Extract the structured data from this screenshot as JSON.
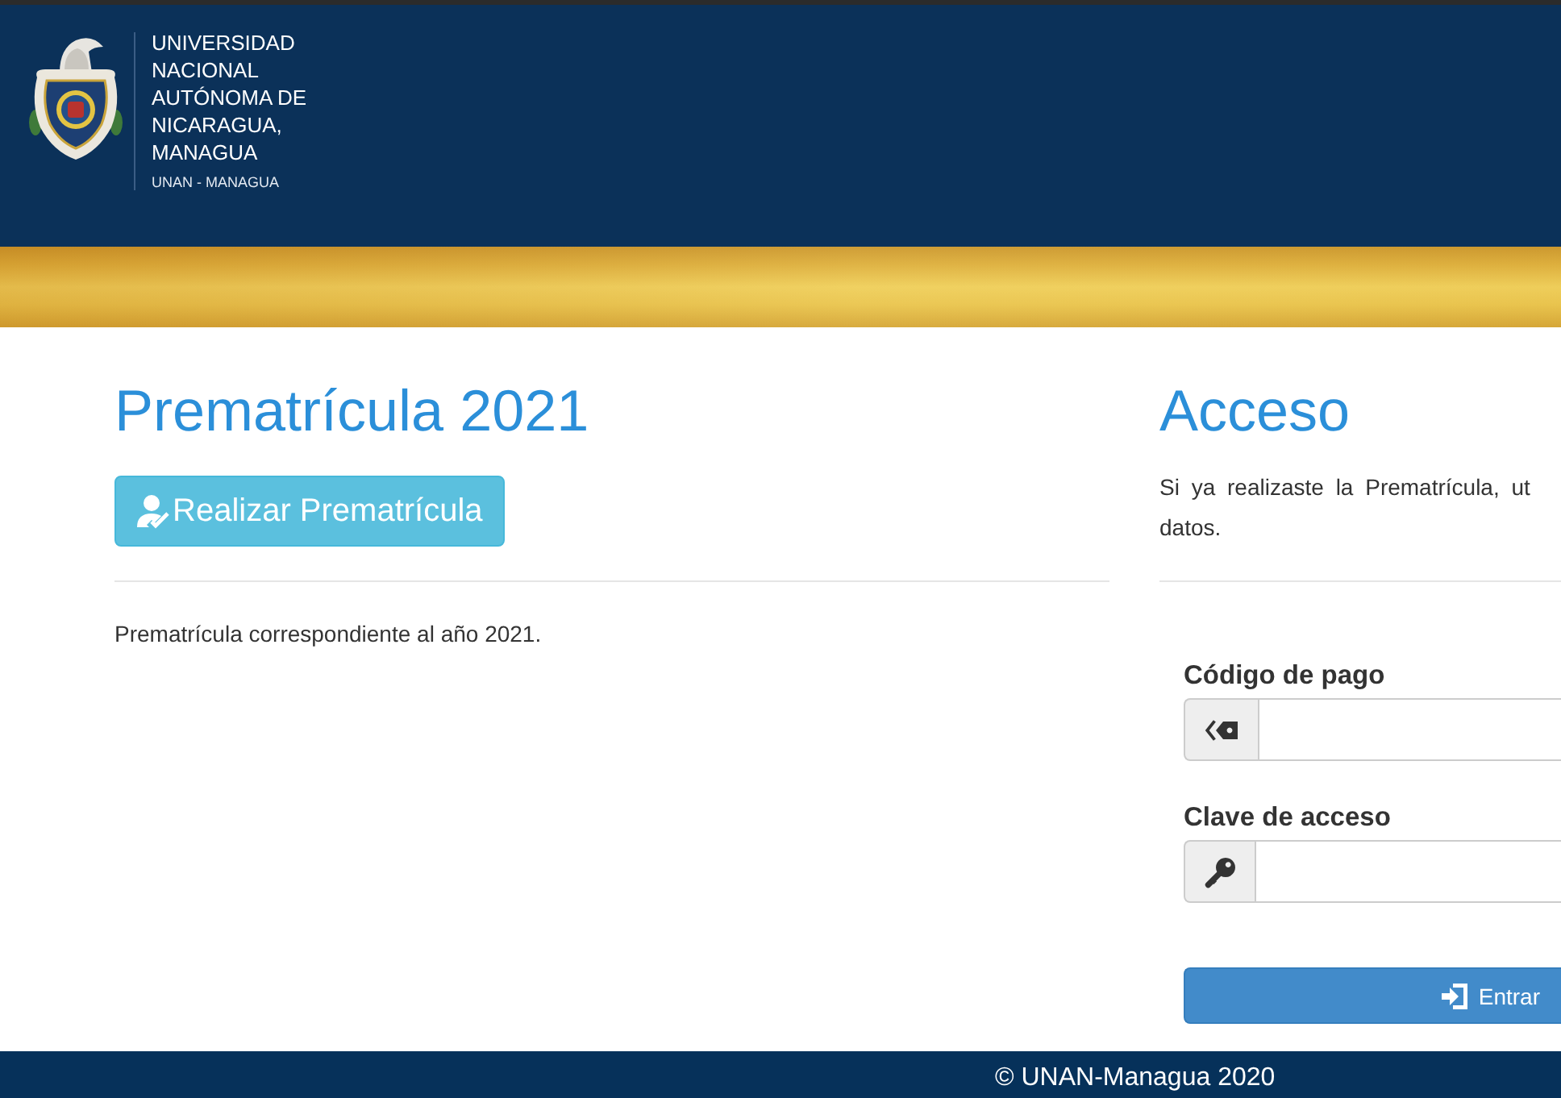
{
  "header": {
    "university_name": "UNIVERSIDAD\nNACIONAL\nAUTÓNOMA DE\nNICARAGUA,\nMANAGUA",
    "acronym": "UNAN - MANAGUA"
  },
  "prematricula": {
    "title": "Prematrícula 2021",
    "button": "Realizar Prematrícula",
    "description": "Prematrícula correspondiente al año 2021."
  },
  "access": {
    "title": "Acceso",
    "intro": "Si ya realizaste la Prematrícula, ut\ndatos.",
    "fields": [
      {
        "label": "Código de pago",
        "kind": "tag"
      },
      {
        "label": "Clave de acceso",
        "kind": "key"
      }
    ],
    "submit": "Entrar"
  },
  "footer": {
    "text": "© UNAN-Managua 2020"
  }
}
